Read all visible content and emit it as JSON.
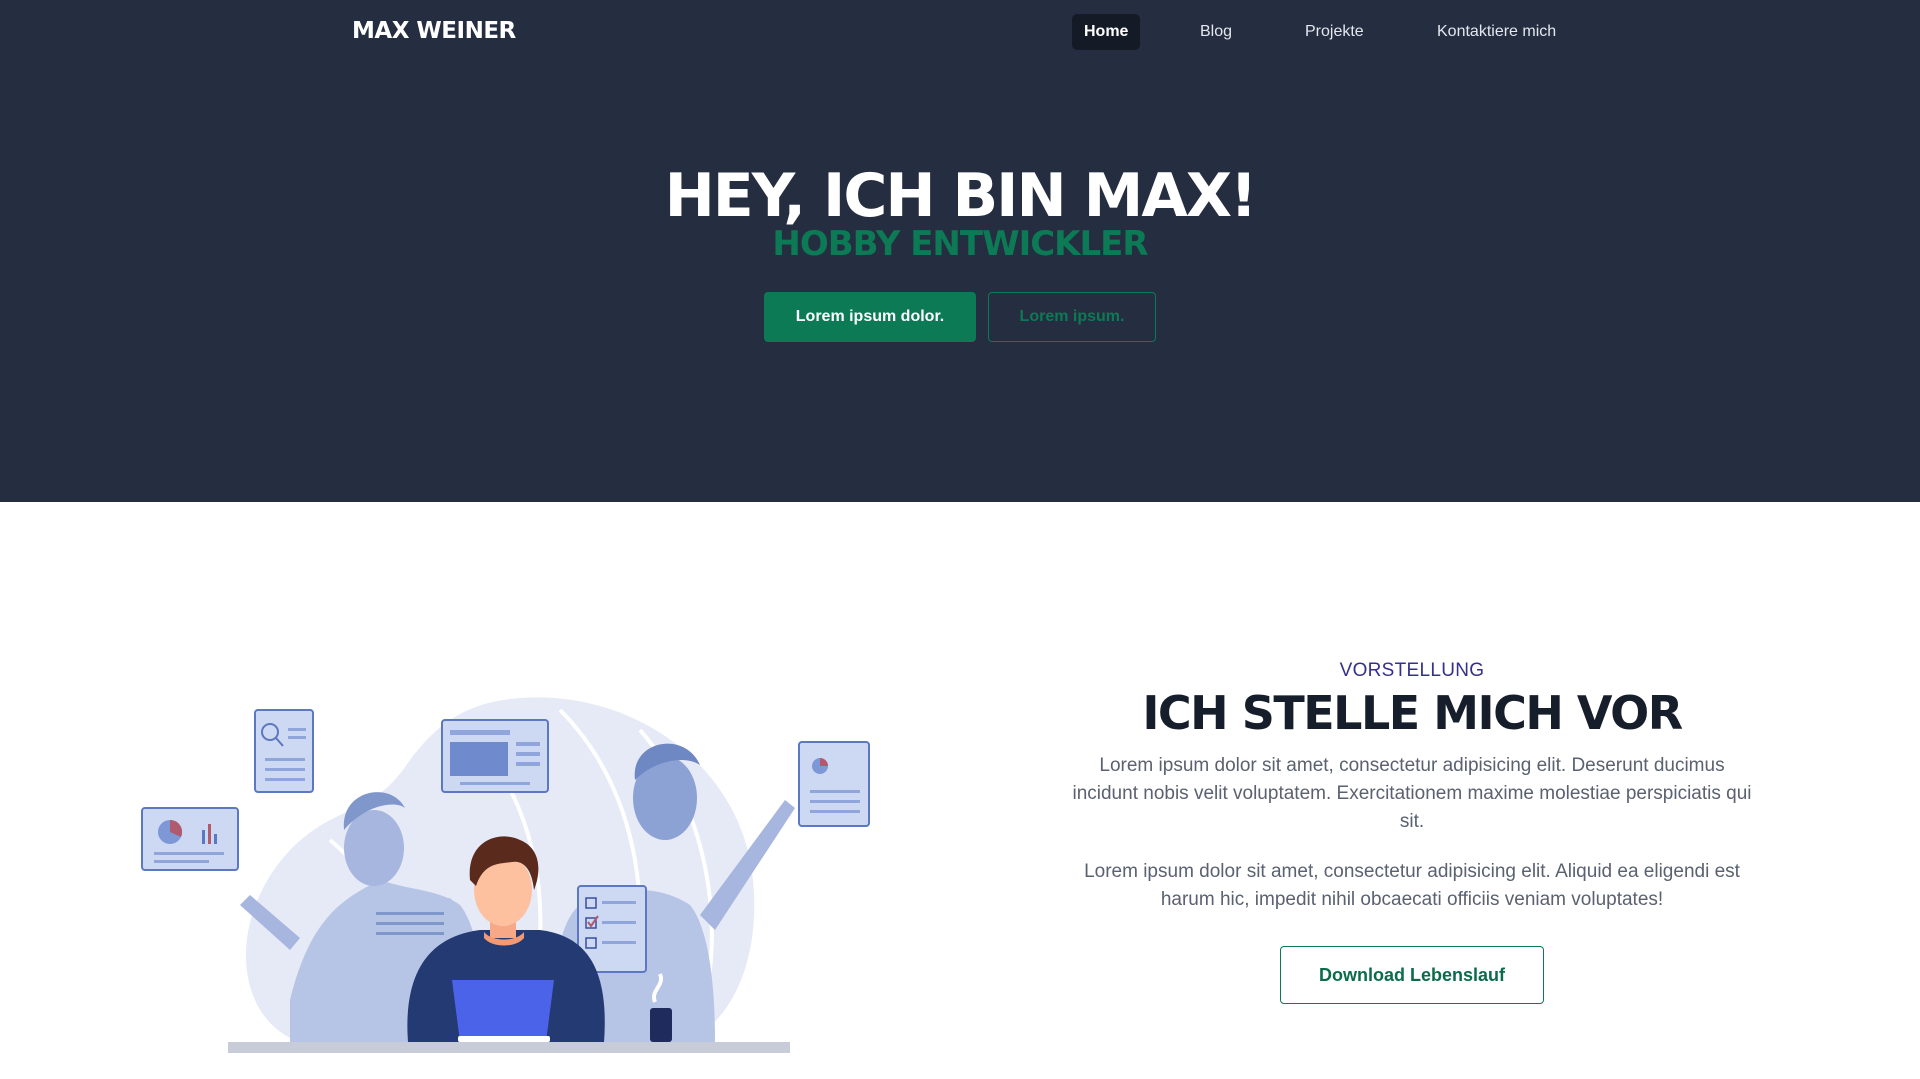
{
  "brand": {
    "name": "MAX WEINER"
  },
  "nav": {
    "items": [
      {
        "label": "Home"
      },
      {
        "label": "Blog"
      },
      {
        "label": "Projekte"
      },
      {
        "label": "Kontaktiere mich"
      }
    ]
  },
  "hero": {
    "title": "HEY, ICH BIN MAX!",
    "subtitle": "HOBBY ENTWICKLER",
    "primary_button": "Lorem ipsum dolor.",
    "secondary_button": "Lorem ipsum."
  },
  "about": {
    "eyebrow": "VORSTELLUNG",
    "title": "ICH STELLE MICH VOR",
    "paragraph_1": "Lorem ipsum dolor sit amet, consectetur adipisicing elit. Deserunt ducimus incidunt nobis velit voluptatem. Exercitationem maxime molestiae perspiciatis qui sit.",
    "paragraph_2": "Lorem ipsum dolor sit amet, consectetur adipisicing elit. Aliquid ea eligendi est harum hic, impedit nihil obcaecati officiis veniam voluptates!",
    "download_button": "Download Lebenslauf"
  },
  "colors": {
    "hero_background": "#252e40",
    "accent_green": "#0b7a55",
    "eyebrow_blue": "#34318a",
    "title_dark": "#161d2b",
    "body_text": "#5a6170",
    "illustration_blue": "#4a63e8"
  }
}
